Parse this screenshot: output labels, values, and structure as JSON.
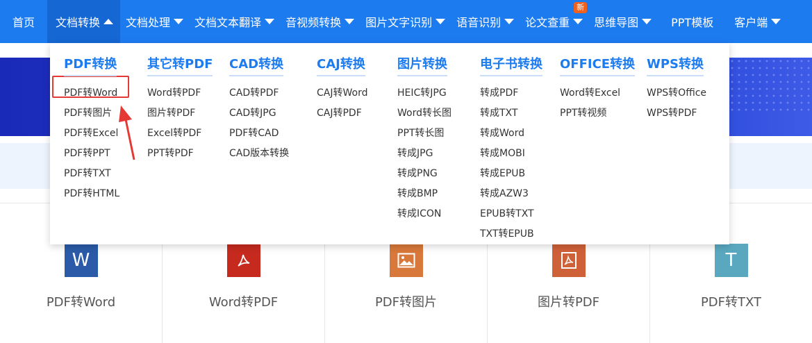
{
  "nav": {
    "items": [
      {
        "label": "首页"
      },
      {
        "label": "文档转换"
      },
      {
        "label": "文档处理"
      },
      {
        "label": "文档文本翻译"
      },
      {
        "label": "音视频转换"
      },
      {
        "label": "图片文字识别"
      },
      {
        "label": "语音识别"
      },
      {
        "label": "论文查重"
      },
      {
        "label": "思维导图"
      },
      {
        "label": "PPT模板"
      },
      {
        "label": "客户端"
      }
    ],
    "new_badge": "新"
  },
  "dropdown": {
    "columns": [
      {
        "title": "PDF转换",
        "items": [
          "PDF转Word",
          "PDF转图片",
          "PDF转Excel",
          "PDF转PPT",
          "PDF转TXT",
          "PDF转HTML"
        ]
      },
      {
        "title": "其它转PDF",
        "items": [
          "Word转PDF",
          "图片转PDF",
          "Excel转PDF",
          "PPT转PDF"
        ]
      },
      {
        "title": "CAD转换",
        "items": [
          "CAD转PDF",
          "CAD转JPG",
          "PDF转CAD",
          "CAD版本转换"
        ]
      },
      {
        "title": "CAJ转换",
        "items": [
          "CAJ转Word",
          "CAJ转PDF"
        ]
      },
      {
        "title": "图片转换",
        "items": [
          "HEIC转JPG",
          "Word转长图",
          "PPT转长图",
          "转成JPG",
          "转成PNG",
          "转成BMP",
          "转成ICON"
        ]
      },
      {
        "title": "电子书转换",
        "items": [
          "转成PDF",
          "转成TXT",
          "转成Word",
          "转成MOBI",
          "转成EPUB",
          "转成AZW3",
          "EPUB转TXT",
          "TXT转EPUB"
        ]
      },
      {
        "title": "OFFICE转换",
        "items": [
          "Word转Excel",
          "PPT转视频"
        ]
      },
      {
        "title": "WPS转换",
        "items": [
          "WPS转Office",
          "WPS转PDF"
        ]
      }
    ]
  },
  "cards": [
    {
      "label": "PDF转Word",
      "icon": "word-icon",
      "glyph": "W",
      "color": "#2b5ba8"
    },
    {
      "label": "Word转PDF",
      "icon": "pdf-icon",
      "glyph": "",
      "color": "#c62a1e"
    },
    {
      "label": "PDF转图片",
      "icon": "image-icon",
      "glyph": "",
      "color": "#d8783a"
    },
    {
      "label": "图片转PDF",
      "icon": "pdf-icon",
      "glyph": "",
      "color": "#cf6139"
    },
    {
      "label": "PDF转TXT",
      "icon": "txt-icon",
      "glyph": "T",
      "color": "#5aa8bf"
    }
  ],
  "colors": {
    "nav": "#1d7bf0",
    "accent": "#1d7bf0",
    "highlight": "#e53935"
  }
}
